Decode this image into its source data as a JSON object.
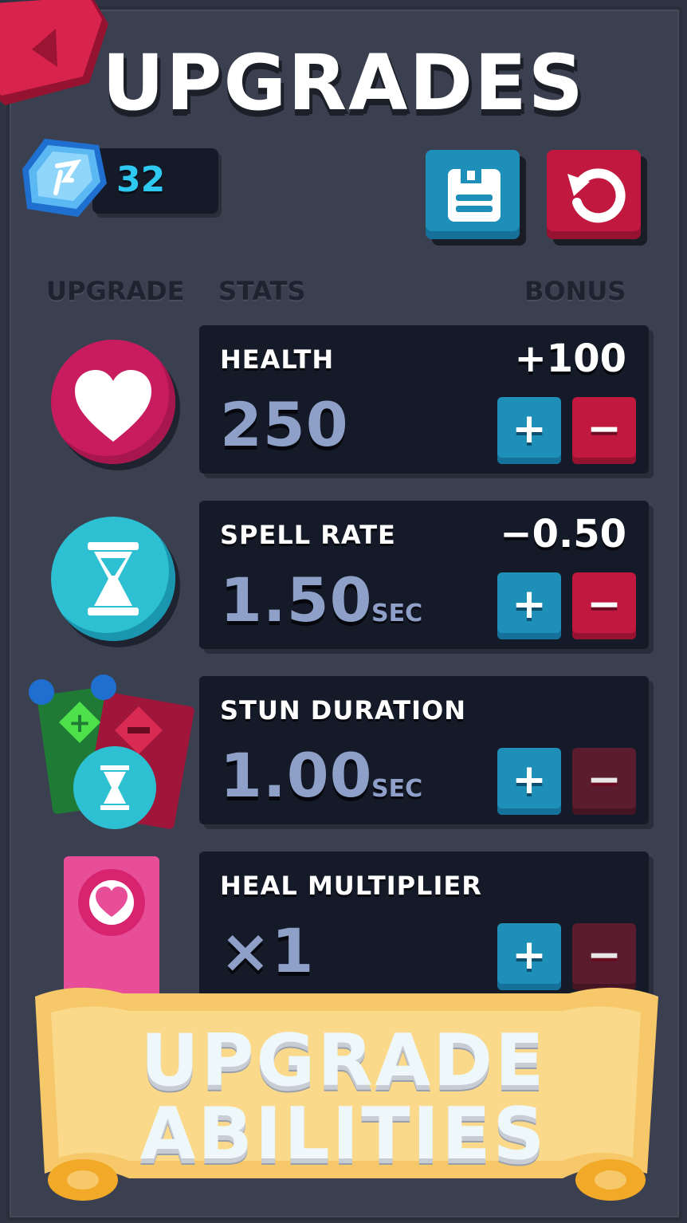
{
  "screen": {
    "title": "UPGRADES",
    "gem_count": "32"
  },
  "columns": {
    "upgrade": "UPGRADE",
    "stats": "STATS",
    "bonus": "BONUS"
  },
  "buttons": {
    "plus": "+",
    "minus": "−"
  },
  "rows": [
    {
      "name": "HEALTH",
      "value": "250",
      "unit": "",
      "bonus": "+100",
      "icon": "heart-icon",
      "color": "#c81c5e"
    },
    {
      "name": "SPELL RATE",
      "value": "1.50",
      "unit": "SEC",
      "bonus": "−0.50",
      "icon": "hourglass-icon",
      "color": "#1fa8c0"
    },
    {
      "name": "STUN DURATION",
      "value": "1.00",
      "unit": "SEC",
      "bonus": "",
      "icon": "stun-cards-icon",
      "color": "#1fa8c0"
    },
    {
      "name": "HEAL MULTIPLIER",
      "value": "×1",
      "unit": "",
      "bonus": "",
      "icon": "heart-card-icon",
      "color": "#e84d97"
    }
  ],
  "banner": {
    "line1": "UPGRADE",
    "line2": "ABILITIES"
  },
  "colors": {
    "background": "#3b4050",
    "panel": "#151a29",
    "plus_button": "#1e8fb8",
    "minus_button": "#c0183e",
    "gem_text": "#2ec9f0",
    "stat_value": "#8fa0c8"
  }
}
